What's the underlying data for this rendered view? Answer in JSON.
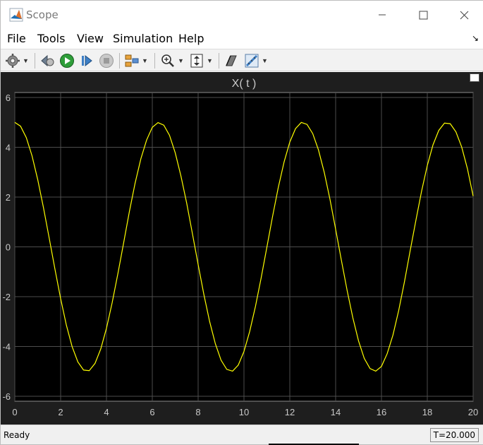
{
  "window": {
    "title": "Scope"
  },
  "menu": {
    "file": "File",
    "tools": "Tools",
    "view": "View",
    "simulation": "Simulation",
    "help": "Help"
  },
  "toolbar": {
    "icons": [
      "gear-icon",
      "restore-icon",
      "run-icon",
      "step-forward-icon",
      "stop-icon",
      "layout-icon",
      "zoom-in-icon",
      "scale-axes-icon",
      "highlight-block-icon",
      "measurements-icon"
    ]
  },
  "status": {
    "left": "Ready",
    "right": "T=20.000"
  },
  "colors": {
    "axes_bg": "#000000",
    "frame_bg": "#1e1e1e",
    "line": "#ffff00",
    "grid": "#4d4d4d",
    "text": "#c8c8c8"
  },
  "chart_data": {
    "type": "line",
    "title": "X( t )",
    "xlim": [
      0,
      20
    ],
    "ylim": [
      -6.2,
      6.2
    ],
    "xticks": [
      0,
      2,
      4,
      6,
      8,
      10,
      12,
      14,
      16,
      18,
      20
    ],
    "yticks": [
      6,
      4,
      2,
      0,
      -2,
      -4,
      -6
    ],
    "grid": true,
    "series": [
      {
        "x": [
          0,
          0.25,
          0.5,
          0.75,
          1,
          1.25,
          1.5,
          1.75,
          2,
          2.25,
          2.5,
          2.75,
          3,
          3.25,
          3.5,
          3.75,
          4,
          4.25,
          4.5,
          4.75,
          5,
          5.25,
          5.5,
          5.75,
          6,
          6.25,
          6.5,
          6.75,
          7,
          7.25,
          7.5,
          7.75,
          8,
          8.25,
          8.5,
          8.75,
          9,
          9.25,
          9.5,
          9.75,
          10,
          10.25,
          10.5,
          10.75,
          11,
          11.25,
          11.5,
          11.75,
          12,
          12.25,
          12.5,
          12.75,
          13,
          13.25,
          13.5,
          13.75,
          14,
          14.25,
          14.5,
          14.75,
          15,
          15.25,
          15.5,
          15.75,
          16,
          16.25,
          16.5,
          16.75,
          17,
          17.25,
          17.5,
          17.75,
          18,
          18.25,
          18.5,
          18.75,
          19,
          19.25,
          19.5,
          19.75,
          20
        ],
        "y": [
          5.0,
          4.85,
          4.39,
          3.66,
          2.7,
          1.58,
          0.35,
          -0.89,
          -2.08,
          -3.14,
          -4.01,
          -4.62,
          -4.95,
          -4.97,
          -4.68,
          -4.1,
          -3.27,
          -2.24,
          -1.06,
          0.17,
          1.42,
          2.56,
          3.54,
          4.29,
          4.8,
          4.99,
          4.89,
          4.48,
          3.78,
          2.85,
          1.75,
          0.53,
          -0.71,
          -1.91,
          -3.0,
          -3.89,
          -4.55,
          -4.92,
          -4.99,
          -4.75,
          -4.2,
          -3.4,
          -2.39,
          -1.24,
          -0.01,
          1.23,
          2.39,
          3.41,
          4.21,
          4.75,
          5.0,
          4.92,
          4.55,
          3.9,
          3.0,
          1.92,
          0.71,
          -0.53,
          -1.75,
          -2.85,
          -3.78,
          -4.48,
          -4.89,
          -4.99,
          -4.8,
          -4.29,
          -3.54,
          -2.56,
          -1.42,
          -0.17,
          1.06,
          2.24,
          3.27,
          4.1,
          4.68,
          4.97,
          4.95,
          4.62,
          4.01,
          3.14,
          2.04
        ]
      }
    ]
  }
}
